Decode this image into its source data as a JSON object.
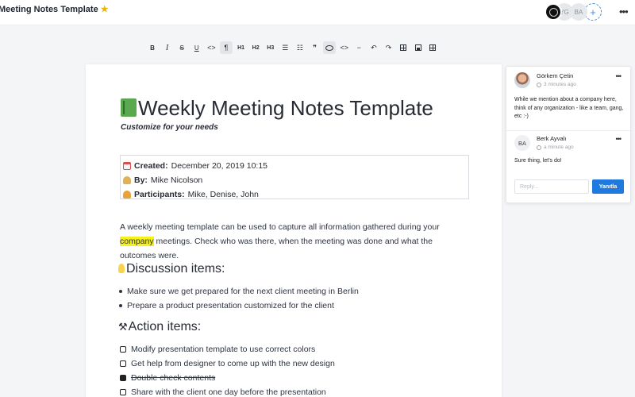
{
  "header": {
    "title": "Meeting Notes Template",
    "star_icon": "star-icon",
    "avatars": [
      {
        "initials": ""
      },
      {
        "initials": "YG"
      },
      {
        "initials": "BA"
      }
    ],
    "add_label": "+",
    "more_label": "•••"
  },
  "toolbar": {
    "items": [
      {
        "name": "bold",
        "label": "B"
      },
      {
        "name": "italic",
        "label": "I"
      },
      {
        "name": "strikethrough",
        "label": "S"
      },
      {
        "name": "underline",
        "label": "U"
      },
      {
        "name": "code",
        "label": "<>"
      },
      {
        "name": "paragraph",
        "label": "¶"
      },
      {
        "name": "h1",
        "label": "H1"
      },
      {
        "name": "h2",
        "label": "H2"
      },
      {
        "name": "h3",
        "label": "H3"
      },
      {
        "name": "bullet-list",
        "label": "☰"
      },
      {
        "name": "ordered-list",
        "label": "☷"
      },
      {
        "name": "quote",
        "label": "❞"
      },
      {
        "name": "comment",
        "label": ""
      },
      {
        "name": "embed",
        "label": "<>"
      },
      {
        "name": "divider",
        "label": "−"
      },
      {
        "name": "undo",
        "label": "↶"
      },
      {
        "name": "redo",
        "label": "↷"
      },
      {
        "name": "table",
        "label": ""
      },
      {
        "name": "image",
        "label": ""
      },
      {
        "name": "template",
        "label": ""
      }
    ]
  },
  "document": {
    "title": "Weekly Meeting Notes Template",
    "subtitle": "Customize for your needs",
    "meta": {
      "created_label": "Created:",
      "created_value": "December 20, 2019 10:15",
      "by_label": "By:",
      "by_value": "Mike Nicolson",
      "participants_label": "Participants:",
      "participants_value": "Mike, Denise, John"
    },
    "intro_before": "A weekly meeting template can be used to capture all information gathered during your ",
    "intro_highlight": "company",
    "intro_after": " meetings. Check who was there, when the meeting was done and what the outcomes were.",
    "discussion_heading": "Discussion items:",
    "discussion_items": [
      "Make sure we get prepared for the next client meeting in Berlin",
      "Prepare a product presentation customized for the client"
    ],
    "action_heading": "Action items:",
    "action_items": [
      {
        "text": "Modify presentation template to use correct colors",
        "done": false
      },
      {
        "text": "Get help from designer to come up with the new design",
        "done": false
      },
      {
        "text": "Double check contents",
        "done": true
      },
      {
        "text": "Share with the client one day before the presentation",
        "done": false
      }
    ]
  },
  "comments": {
    "items": [
      {
        "author": "Görkem Çetin",
        "time": "3 minutes ago",
        "text": "While we mention about a company here, think of any organization - like a team, gang, etc :-)",
        "initials": ""
      },
      {
        "author": "Berk Ayvalı",
        "time": "a minute ago",
        "text": "Sure thing, let's do!",
        "initials": "BA"
      }
    ],
    "more_label": "•••",
    "reply_placeholder": "Reply...",
    "reply_button": "Yanıtla"
  },
  "colors": {
    "accent": "#1f7ae0",
    "highlight": "#f6f01c",
    "star": "#f0b400"
  }
}
